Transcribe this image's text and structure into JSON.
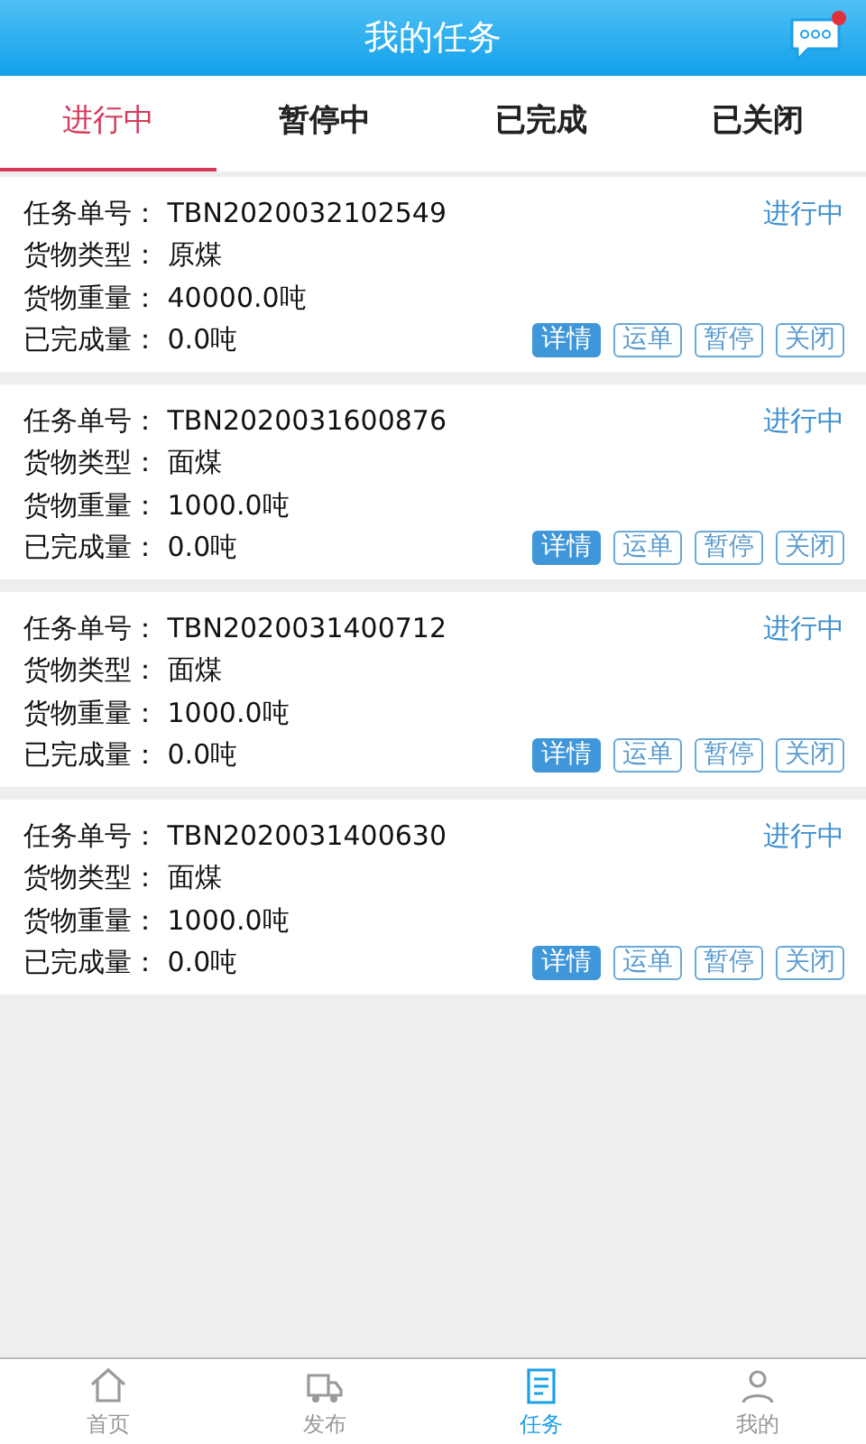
{
  "header": {
    "title": "我的任务",
    "message_badge": true
  },
  "tabs": [
    {
      "label": "进行中",
      "selected": true
    },
    {
      "label": "暂停中",
      "selected": false
    },
    {
      "label": "已完成",
      "selected": false
    },
    {
      "label": "已关闭",
      "selected": false
    }
  ],
  "tasks": [
    {
      "fields": [
        {
          "label": "任务单号：",
          "value": "TBN2020032102549"
        },
        {
          "label": "货物类型：",
          "value": "原煤"
        },
        {
          "label": "货物重量：",
          "value": "40000.0吨"
        },
        {
          "label": "已完成量：",
          "value": "0.0吨"
        }
      ],
      "status": "进行中",
      "actions": [
        {
          "label": "详情",
          "kind": "filled"
        },
        {
          "label": "运单",
          "kind": "outline"
        },
        {
          "label": "暂停",
          "kind": "outline"
        },
        {
          "label": "关闭",
          "kind": "outline"
        }
      ]
    },
    {
      "fields": [
        {
          "label": "任务单号：",
          "value": "TBN2020031600876"
        },
        {
          "label": "货物类型：",
          "value": "面煤"
        },
        {
          "label": "货物重量：",
          "value": "1000.0吨"
        },
        {
          "label": "已完成量：",
          "value": "0.0吨"
        }
      ],
      "status": "进行中",
      "actions": [
        {
          "label": "详情",
          "kind": "filled"
        },
        {
          "label": "运单",
          "kind": "outline"
        },
        {
          "label": "暂停",
          "kind": "outline"
        },
        {
          "label": "关闭",
          "kind": "outline"
        }
      ]
    },
    {
      "fields": [
        {
          "label": "任务单号：",
          "value": "TBN2020031400712"
        },
        {
          "label": "货物类型：",
          "value": "面煤"
        },
        {
          "label": "货物重量：",
          "value": "1000.0吨"
        },
        {
          "label": "已完成量：",
          "value": "0.0吨"
        }
      ],
      "status": "进行中",
      "actions": [
        {
          "label": "详情",
          "kind": "filled"
        },
        {
          "label": "运单",
          "kind": "outline"
        },
        {
          "label": "暂停",
          "kind": "outline"
        },
        {
          "label": "关闭",
          "kind": "outline"
        }
      ]
    },
    {
      "fields": [
        {
          "label": "任务单号：",
          "value": "TBN2020031400630"
        },
        {
          "label": "货物类型：",
          "value": "面煤"
        },
        {
          "label": "货物重量：",
          "value": "1000.0吨"
        },
        {
          "label": "已完成量：",
          "value": "0.0吨"
        }
      ],
      "status": "进行中",
      "actions": [
        {
          "label": "详情",
          "kind": "filled"
        },
        {
          "label": "运单",
          "kind": "outline"
        },
        {
          "label": "暂停",
          "kind": "outline"
        },
        {
          "label": "关闭",
          "kind": "outline"
        }
      ]
    }
  ],
  "bottom_nav": [
    {
      "label": "首页",
      "selected": false
    },
    {
      "label": "发布",
      "selected": false
    },
    {
      "label": "任务",
      "selected": true
    },
    {
      "label": "我的",
      "selected": false
    }
  ]
}
